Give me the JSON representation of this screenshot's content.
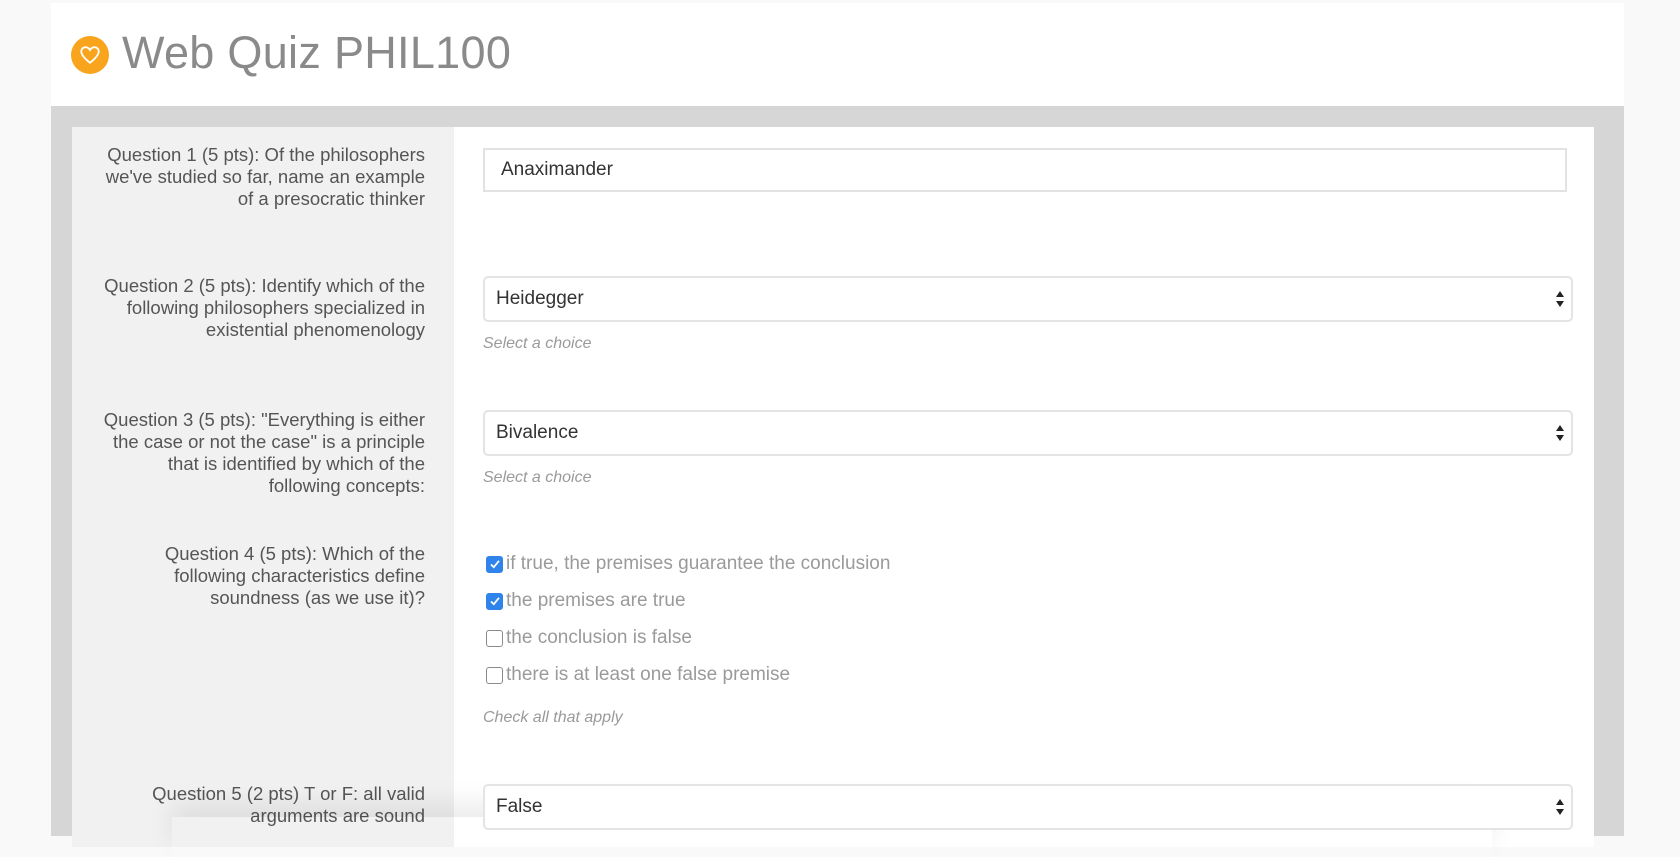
{
  "header": {
    "title": "Web Quiz PHIL100",
    "logo_icon": "heart-icon",
    "logo_color": "#f8a41c"
  },
  "questions": [
    {
      "label": "Question 1 (5 pts): Of the philosophers we've studied so far, name an example of a presocratic thinker",
      "type": "text",
      "value": "Anaximander"
    },
    {
      "label": "Question 2 (5 pts): Identify which of the following philosophers specialized in existential phenomenology",
      "type": "select",
      "value": "Heidegger",
      "hint": "Select a choice"
    },
    {
      "label": "Question 3 (5 pts): \"Everything is either the case or not the case\" is a principle that is identified by which of the following concepts:",
      "type": "select",
      "value": "Bivalence",
      "hint": "Select a choice"
    },
    {
      "label": "Question 4 (5 pts): Which of the following characteristics define soundness (as we use it)?",
      "type": "checkbox",
      "options": [
        {
          "label": "if true, the premises guarantee the conclusion",
          "checked": true
        },
        {
          "label": "the premises are true",
          "checked": true
        },
        {
          "label": "the conclusion is false",
          "checked": false
        },
        {
          "label": "there is at least one false premise",
          "checked": false
        }
      ],
      "hint": "Check all that apply"
    },
    {
      "label": "Question 5 (2 pts) T or F: all valid arguments are sound",
      "type": "select",
      "value": "False"
    }
  ],
  "colors": {
    "checkbox_checked": "#2f84eb"
  }
}
